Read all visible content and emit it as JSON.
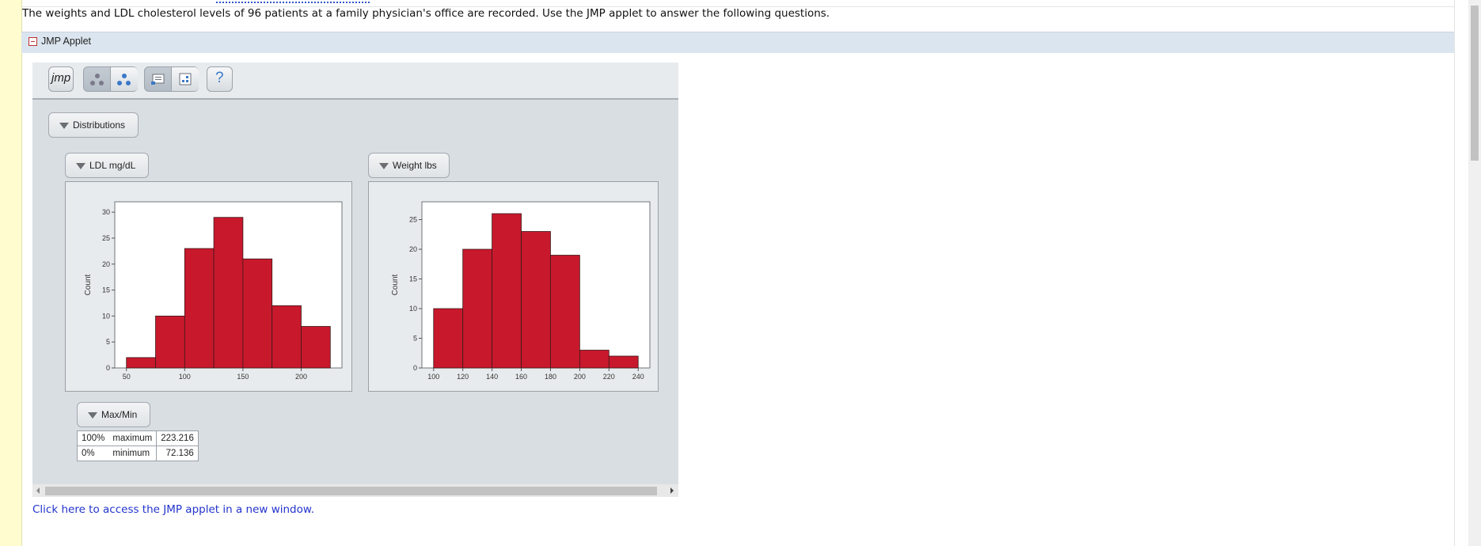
{
  "intro_text": "The weights and LDL cholesterol levels of 96 patients at a family physician's office are recorded. Use the JMP applet to answer the following questions.",
  "applet_section": {
    "title": "JMP Applet"
  },
  "toolbar": {
    "logo_text": "jmp",
    "help_label": "?"
  },
  "distributions_label": "Distributions",
  "ldl": {
    "header": "LDL mg/dL",
    "ylabel": "Count"
  },
  "weight": {
    "header": "Weight lbs",
    "ylabel": "Count"
  },
  "maxmin": {
    "header": "Max/Min",
    "rows": [
      {
        "pct": "100%",
        "label": "maximum",
        "value": "223.216"
      },
      {
        "pct": "0%",
        "label": "minimum",
        "value": "72.136"
      }
    ]
  },
  "link_text": "Click here to access the JMP applet in a new window.",
  "colors": {
    "bar": "#c8182c",
    "panel": "#d9dee3"
  },
  "chart_data": [
    {
      "type": "bar",
      "name": "LDL mg/dL histogram",
      "bins": [
        [
          50,
          75
        ],
        [
          75,
          100
        ],
        [
          100,
          125
        ],
        [
          125,
          150
        ],
        [
          150,
          175
        ],
        [
          175,
          200
        ],
        [
          200,
          225
        ]
      ],
      "values": [
        2,
        10,
        23,
        29,
        21,
        12,
        8
      ],
      "xticks": [
        50,
        100,
        150,
        200
      ],
      "yticks": [
        0,
        5,
        10,
        15,
        20,
        25,
        30
      ],
      "xlim": [
        40,
        235
      ],
      "ylim": [
        0,
        32
      ],
      "ylabel": "Count"
    },
    {
      "type": "bar",
      "name": "Weight lbs histogram",
      "bins": [
        [
          100,
          120
        ],
        [
          120,
          140
        ],
        [
          140,
          160
        ],
        [
          160,
          180
        ],
        [
          180,
          200
        ],
        [
          200,
          220
        ],
        [
          220,
          240
        ]
      ],
      "values": [
        10,
        20,
        26,
        23,
        19,
        3,
        2
      ],
      "xticks": [
        100,
        120,
        140,
        160,
        180,
        200,
        220,
        240
      ],
      "yticks": [
        0,
        5,
        10,
        15,
        20,
        25
      ],
      "xlim": [
        92,
        248
      ],
      "ylim": [
        0,
        28
      ],
      "ylabel": "Count"
    }
  ]
}
